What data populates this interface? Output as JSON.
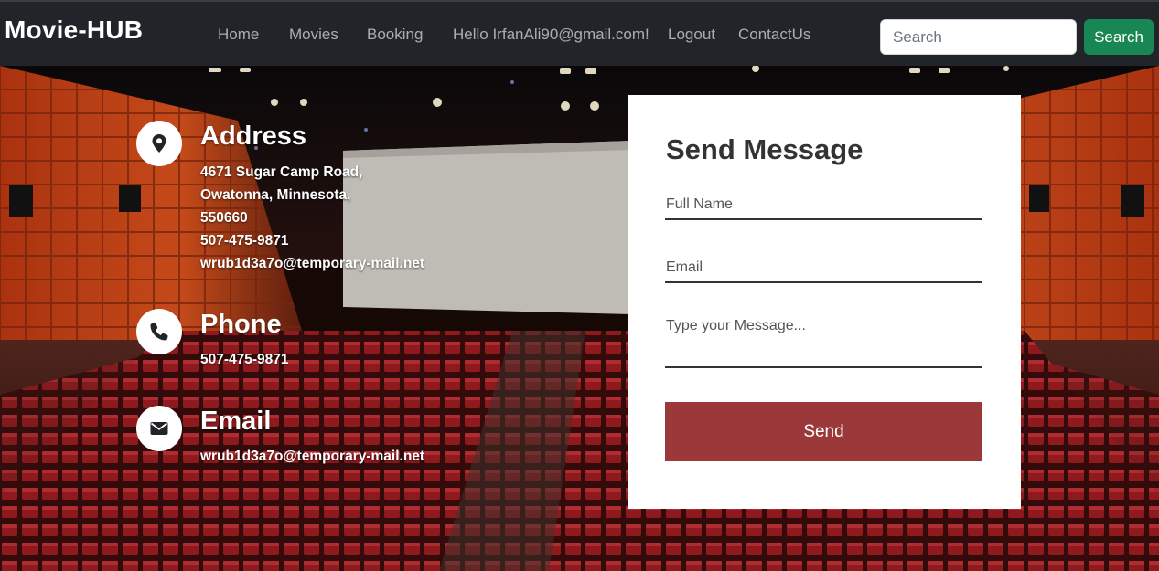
{
  "header": {
    "brand": "Movie-HUB",
    "nav": [
      {
        "label": "Home"
      },
      {
        "label": "Movies"
      },
      {
        "label": "Booking"
      },
      {
        "label": "Hello IrfanAli90@gmail.com!"
      },
      {
        "label": "Logout"
      },
      {
        "label": "ContactUs"
      }
    ],
    "search": {
      "placeholder": "Search",
      "value": "",
      "button_label": "Search"
    }
  },
  "contact": {
    "address": {
      "icon": "map-marker-icon",
      "title": "Address",
      "lines": [
        "4671 Sugar Camp Road,",
        "Owatonna, Minnesota,",
        "550660",
        "507-475-9871",
        "wrub1d3a7o@temporary-mail.net"
      ]
    },
    "phone": {
      "icon": "phone-icon",
      "title": "Phone",
      "value": "507-475-9871"
    },
    "email": {
      "icon": "envelope-icon",
      "title": "Email",
      "value": "wrub1d3a7o@temporary-mail.net"
    }
  },
  "form": {
    "title": "Send Message",
    "fields": {
      "full_name": {
        "placeholder": "Full Name",
        "value": ""
      },
      "email": {
        "placeholder": "Email",
        "value": ""
      },
      "message": {
        "placeholder": "Type your Message...",
        "value": ""
      }
    },
    "submit_label": "Send"
  },
  "colors": {
    "navbar_bg": "#212529",
    "search_button": "#198754",
    "send_button": "#9b393a",
    "card_bg": "#ffffff"
  }
}
